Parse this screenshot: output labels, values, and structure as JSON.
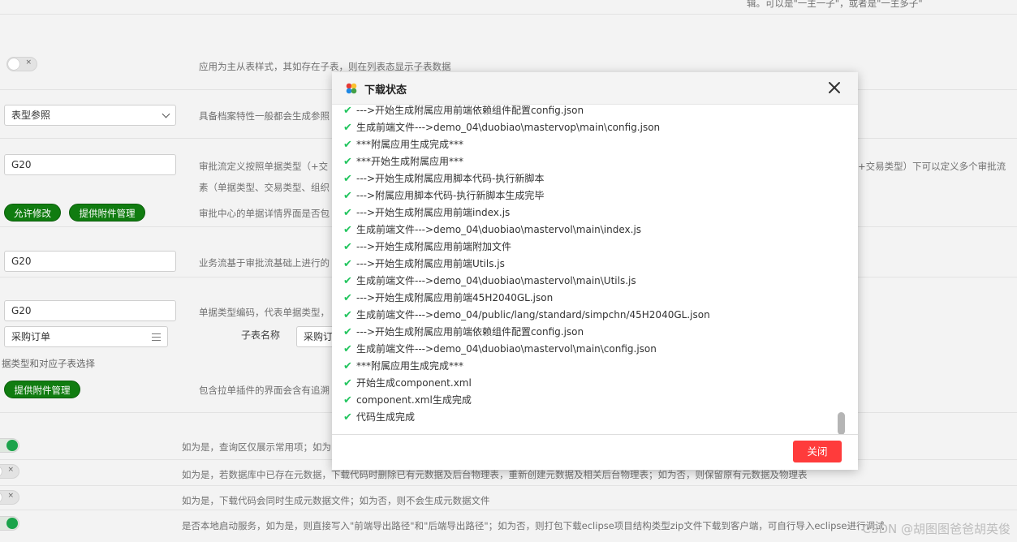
{
  "background": {
    "top_note": "辑。可以是\"一主一子\"，或者是\"一主多子\"",
    "desc_master_detail": "应用为主从表样式，其如存在子表，则在列表态显示子表数据",
    "select_type_ref": "表型参照",
    "desc_archive": "具备档案特性一般都会生成参照",
    "input_g20_1": "G20",
    "desc_approval_1": "审批流定义按照单据类型（+交",
    "desc_approval_1_right": "+交易类型）下可以定义多个审批流",
    "desc_approval_2": "素（单据类型、交易类型、组织",
    "btn_allow_modify": "允许修改",
    "btn_attach_mgmt_1": "提供附件管理",
    "desc_approval_center": "审批中心的单据详情界面是否包",
    "input_g20_2": "G20",
    "desc_business_flow": "业务流基于审批流基础上进行的",
    "input_g20_3": "G20",
    "desc_bill_code": "单据类型编码，代表单据类型，",
    "select_purchase_order": "采购订单",
    "label_child_table": "子表名称",
    "select_child_partial": "采购订",
    "label_bill_child_select": "据类型和对应子表选择",
    "btn_attach_mgmt_2": "提供附件管理",
    "desc_pull_plugin": "包含拉单插件的界面会含有追溯",
    "desc_query_area": "如为是，查询区仅展示常用项；如为",
    "desc_rebuild": "如为是，若数据库中已存在元数据，下载代码时删除已有元数据及后台物理表，重新创建元数据及相关后台物理表；如为否，则保留原有元数据及物理表",
    "desc_metadata_file": "如为是，下载代码会同时生成元数据文件；如为否，则不会生成元数据文件",
    "desc_local_service": "是否本地启动服务，如为是，则直接写入\"前端导出路径\"和\"后端导出路径\"；如为否，则打包下载eclipse项目结构类型zip文件下载到客户端，可自行导入eclipse进行调试",
    "watermark": "CSDN @胡图图爸爸胡英俊",
    "toggle_mark_off": "×",
    "toggle_mark_on": "✓"
  },
  "modal": {
    "title": "下载状态",
    "close_label": "关闭",
    "check_color": "#22c55e",
    "log_lines": [
      "--->开始生成附属应用前端依赖组件配置config.json",
      "生成前端文件--->demo_04\\duobiao\\mastervop\\main\\config.json",
      "***附属应用生成完成***",
      "***开始生成附属应用***",
      "--->开始生成附属应用脚本代码-执行新脚本",
      "--->附属应用脚本代码-执行新脚本生成完毕",
      "--->开始生成附属应用前端index.js",
      "生成前端文件--->demo_04\\duobiao\\mastervol\\main\\index.js",
      "--->开始生成附属应用前端附加文件",
      "--->开始生成附属应用前端Utils.js",
      "生成前端文件--->demo_04\\duobiao\\mastervol\\main\\Utils.js",
      "--->开始生成附属应用前端45H2040GL.json",
      "生成前端文件--->demo_04/public/lang/standard/simpchn/45H2040GL.json",
      "--->开始生成附属应用前端依赖组件配置config.json",
      "生成前端文件--->demo_04\\duobiao\\mastervol\\main\\config.json",
      "***附属应用生成完成***",
      "开始生成component.xml",
      "component.xml生成完成",
      "代码生成完成"
    ]
  }
}
